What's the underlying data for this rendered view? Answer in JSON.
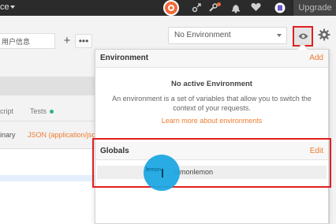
{
  "topbar": {
    "workspace_label": "ce",
    "upgrade_label": "Upgrade"
  },
  "request_tab": {
    "label": "用户信息",
    "add_label": "+",
    "more_label": "•••"
  },
  "request_subtabs": {
    "script_label": "cript",
    "tests_label": "Tests"
  },
  "body": {
    "binary_label": "inary",
    "json_label": "JSON (application/jso"
  },
  "environment": {
    "selected": "No Environment"
  },
  "popover": {
    "environment_title": "Environment",
    "add_label": "Add",
    "no_env_title": "No active Environment",
    "no_env_desc": "An environment is a set of variables that allow you to switch the context of your requests.",
    "learn_more": "Learn more about environments",
    "globals_title": "Globals",
    "edit_label": "Edit",
    "global_value": "lemonlemon"
  },
  "cursor": {
    "key_text": "lemon"
  },
  "colors": {
    "accent": "#f07a2f",
    "highlight": "#e02020",
    "cursor": "#1ea7e1",
    "success": "#2eb67d"
  }
}
